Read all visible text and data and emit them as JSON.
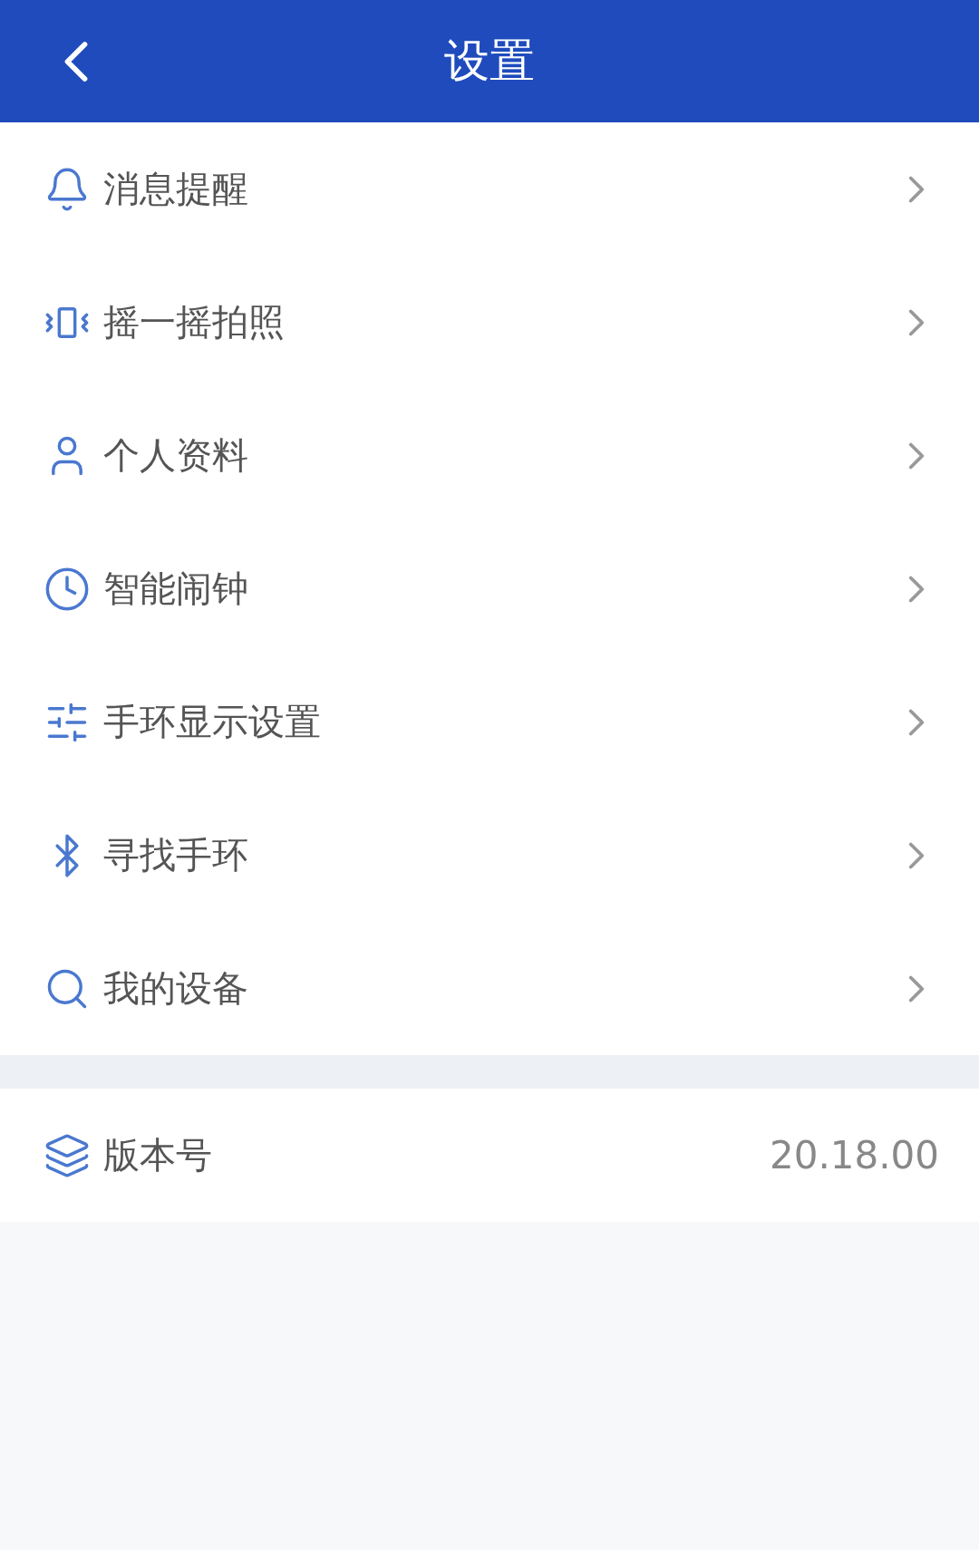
{
  "header": {
    "title": "设置"
  },
  "menu": [
    {
      "kind": "bell",
      "label": "消息提醒"
    },
    {
      "kind": "shake",
      "label": "摇一摇拍照"
    },
    {
      "kind": "user",
      "label": "个人资料"
    },
    {
      "kind": "clock",
      "label": "智能闹钟"
    },
    {
      "kind": "sliders",
      "label": "手环显示设置"
    },
    {
      "kind": "bluetooth",
      "label": "寻找手环"
    },
    {
      "kind": "search",
      "label": "我的设备"
    }
  ],
  "version": {
    "kind": "layers",
    "label": "版本号",
    "value": "20.18.00"
  }
}
